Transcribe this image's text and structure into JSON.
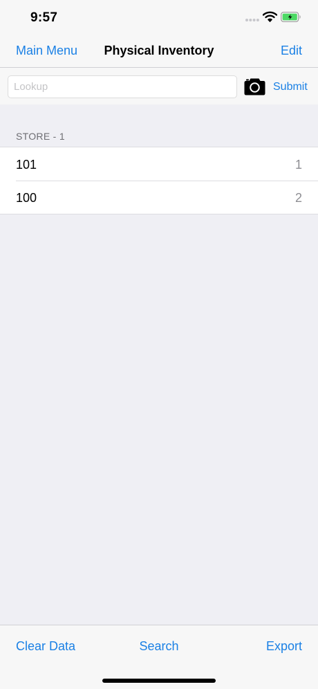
{
  "status_bar": {
    "time": "9:57"
  },
  "nav": {
    "back_label": "Main Menu",
    "title": "Physical Inventory",
    "edit_label": "Edit"
  },
  "lookup": {
    "placeholder": "Lookup",
    "value": "",
    "submit_label": "Submit"
  },
  "section": {
    "header": "STORE - 1",
    "rows": [
      {
        "title": "101",
        "value": "1"
      },
      {
        "title": "100",
        "value": "2"
      }
    ]
  },
  "toolbar": {
    "clear_label": "Clear Data",
    "search_label": "Search",
    "export_label": "Export"
  },
  "icons": {
    "camera": "camera-icon",
    "wifi": "wifi-icon",
    "battery": "battery-charging-icon",
    "signal": "cellular-signal-icon"
  },
  "colors": {
    "accent": "#1a80e5",
    "background": "#efeff4",
    "bar": "#f7f7f7",
    "battery_fill": "#4cd964"
  }
}
